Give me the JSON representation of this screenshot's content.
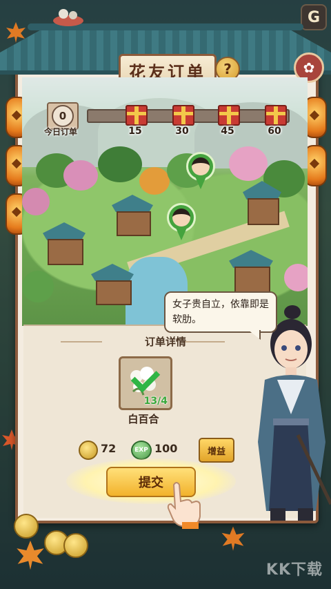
{
  "header": {
    "title": "花友订单",
    "help_label": "?",
    "close_label": "G"
  },
  "progress": {
    "today_count": "0",
    "today_label": "今日订单",
    "value": 0,
    "milestones": [
      "15",
      "30",
      "45",
      "60"
    ]
  },
  "dialogue": {
    "text": "女子贵自立，依靠即是软肋。"
  },
  "order": {
    "section_title": "订单详情",
    "item": {
      "name": "白百合",
      "count": "13/4",
      "completed": true
    },
    "rewards": {
      "coins": "72",
      "exp_icon_label": "EXP",
      "exp": "100"
    },
    "boost_label": "增益",
    "submit_label": "提交"
  },
  "watermark": "KK下载",
  "colors": {
    "frame": "#8c5a3c",
    "accent_gold": "#f2b22b",
    "pin_green": "#45a33e",
    "roof_teal": "#3f7a83"
  }
}
